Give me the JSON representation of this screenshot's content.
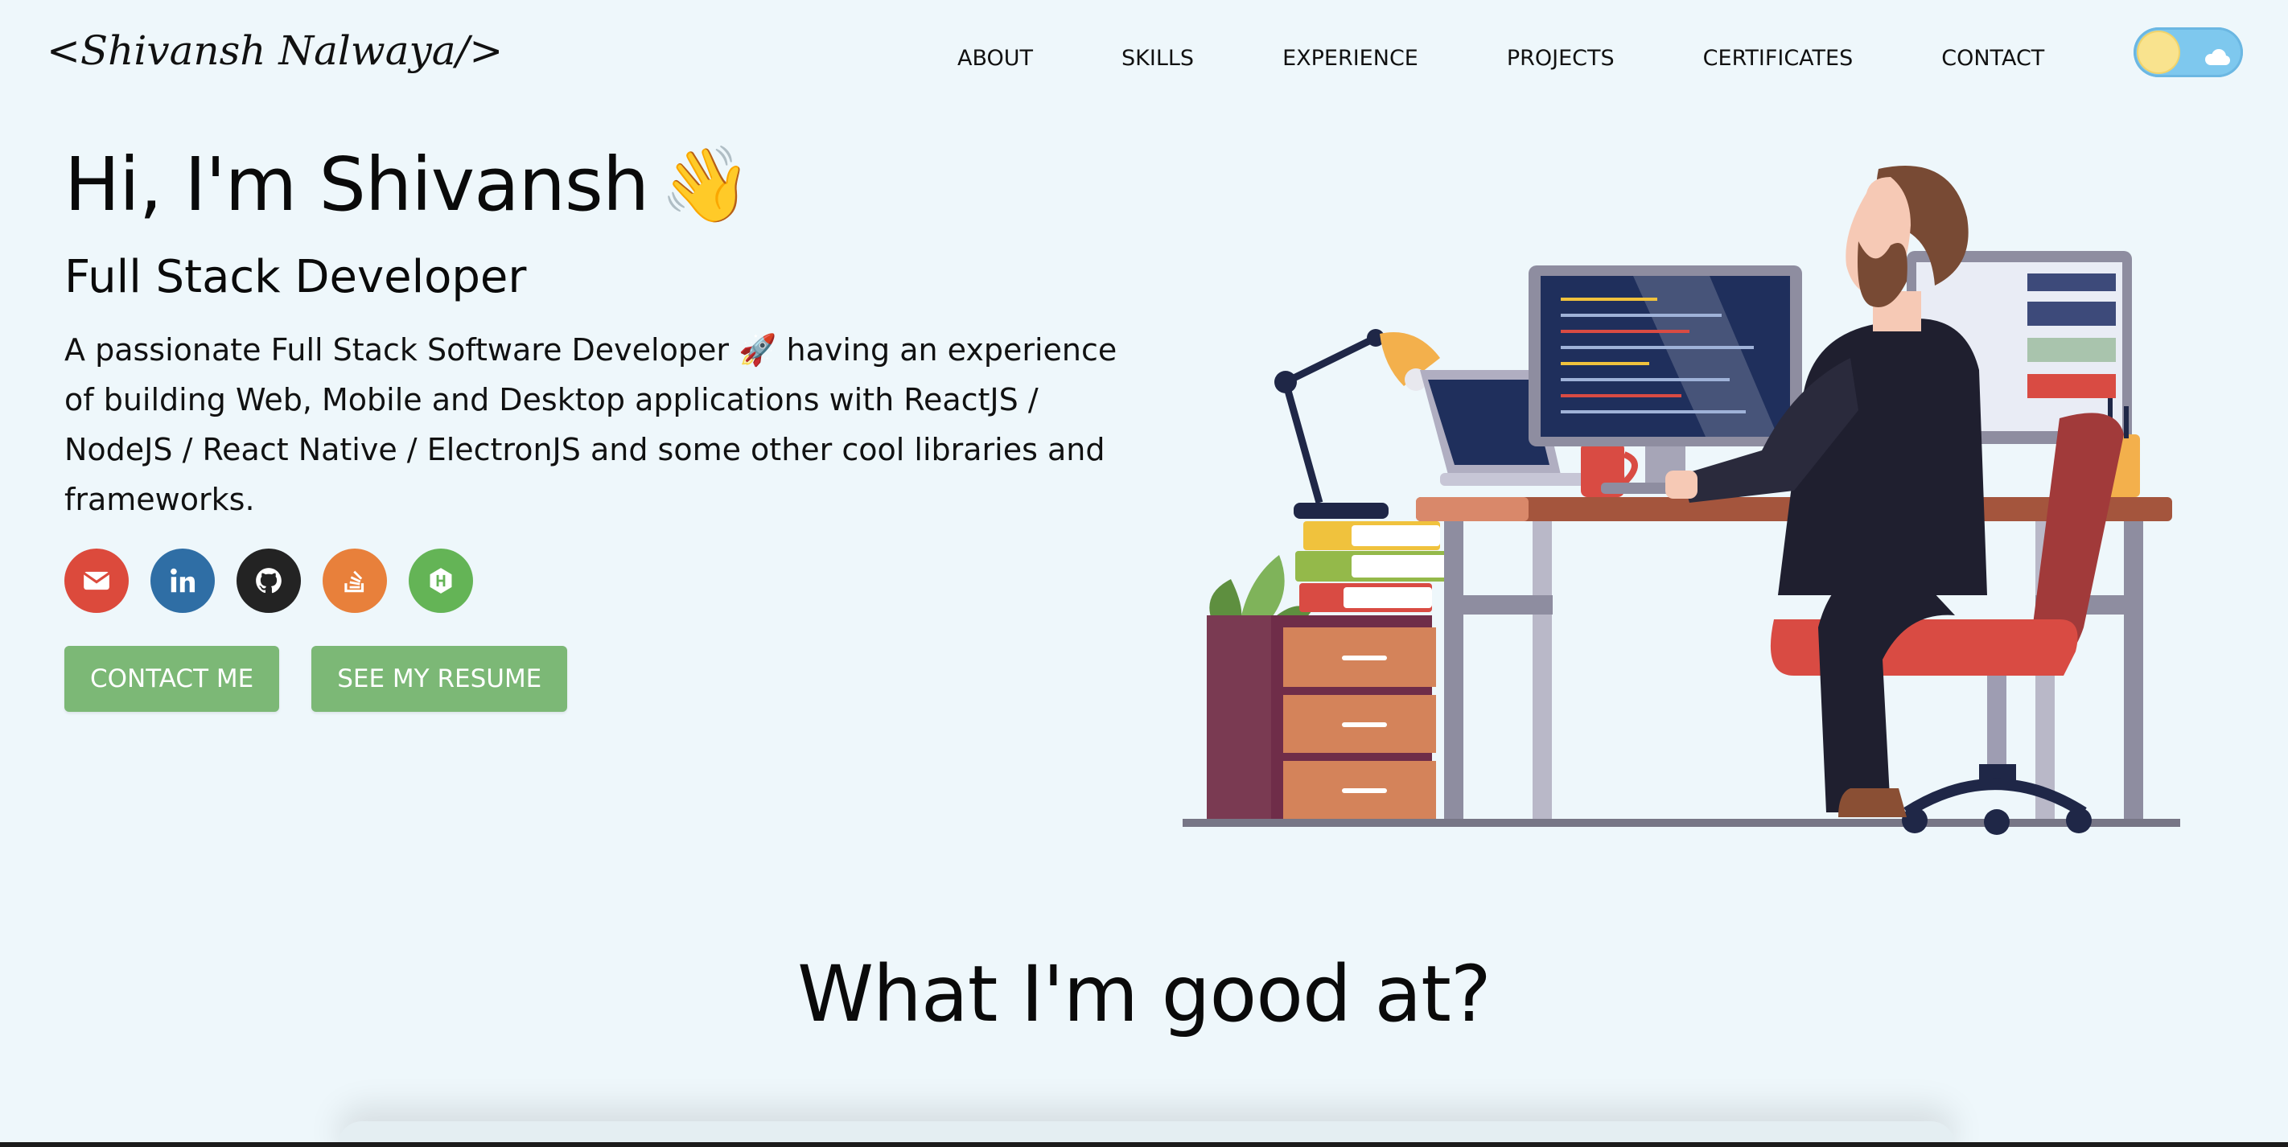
{
  "header": {
    "logo": "<Shivansh Nalwaya/>",
    "nav": [
      "ABOUT",
      "SKILLS",
      "EXPERIENCE",
      "PROJECTS",
      "CERTIFICATES",
      "CONTACT"
    ],
    "theme_toggle": {
      "state": "light"
    }
  },
  "hero": {
    "greeting": "Hi, I'm Shivansh",
    "wave_emoji": "👋",
    "subtitle": "Full Stack Developer",
    "description_start": "A passionate Full Stack Software Developer",
    "rocket_emoji": "🚀",
    "description_end": "having an experience of building Web, Mobile and Desktop applications with ReactJS / NodeJS / React Native / ElectronJS and some other cool libraries and frameworks.",
    "socials": [
      {
        "name": "gmail-icon",
        "color": "#dc4a3c"
      },
      {
        "name": "linkedin-icon",
        "color": "#2f6ea5"
      },
      {
        "name": "github-icon",
        "color": "#232323"
      },
      {
        "name": "stackoverflow-icon",
        "color": "#e8803b"
      },
      {
        "name": "hackerrank-icon",
        "color": "#64b456"
      }
    ],
    "buttons": {
      "contact": "CONTACT ME",
      "resume": "SEE MY RESUME"
    }
  },
  "sections": {
    "skills_title": "What I'm good at?"
  },
  "colors": {
    "background": "#eef7fb",
    "button": "#7cb876",
    "toggle": "#7ec8ee"
  }
}
